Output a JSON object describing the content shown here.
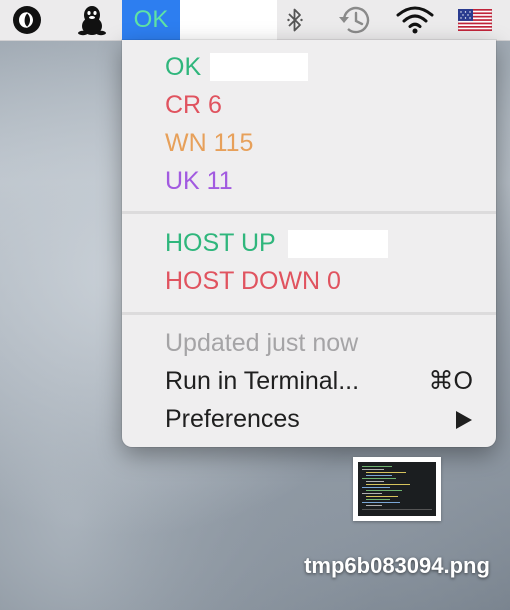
{
  "menubar": {
    "icons": [
      "app-circle-icon",
      "penguin-icon",
      "bluetooth-icon",
      "time-machine-icon",
      "wifi-icon",
      "us-flag-icon"
    ],
    "status_label": "OK"
  },
  "menu": {
    "ok_label": "OK",
    "critical_label": "CR 6",
    "warning_label": "WN 115",
    "unknown_label": "UK 11",
    "host_up_label": "HOST UP",
    "host_down_label": "HOST DOWN 0",
    "updated_label": "Updated just now",
    "run_terminal_label": "Run in Terminal...",
    "run_terminal_shortcut": "⌘O",
    "preferences_label": "Preferences"
  },
  "colors": {
    "ok": "#2fb67c",
    "critical": "#e0535f",
    "warning": "#e7a05a",
    "unknown": "#a25ae0",
    "disabled": "#a5a4a6",
    "highlight": "#2d7ef0"
  },
  "desktop": {
    "file_label": "tmp6b083094.png"
  }
}
